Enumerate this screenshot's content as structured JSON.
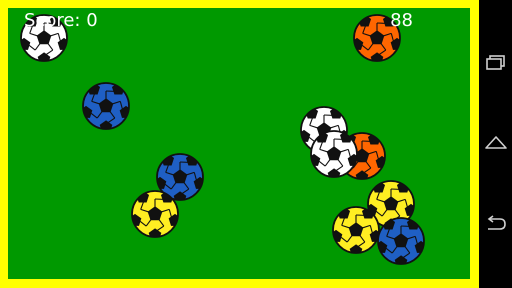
{
  "hud": {
    "score_text": "Score: 0",
    "timer_text": "88"
  },
  "colors": {
    "border": "#ffff00",
    "field": "#009900",
    "balls": {
      "white": "#ffffff",
      "orange": "#ff6600",
      "blue": "#1f5fc4",
      "yellow": "#ffee22"
    }
  },
  "balls": [
    {
      "color": "white"
    },
    {
      "color": "orange"
    },
    {
      "color": "blue"
    },
    {
      "color": "white"
    },
    {
      "color": "orange"
    },
    {
      "color": "white"
    },
    {
      "color": "blue"
    },
    {
      "color": "yellow"
    },
    {
      "color": "yellow"
    },
    {
      "color": "yellow"
    },
    {
      "color": "blue"
    }
  ],
  "navbar": {
    "buttons": [
      "recents-icon",
      "home-icon",
      "back-icon"
    ]
  }
}
